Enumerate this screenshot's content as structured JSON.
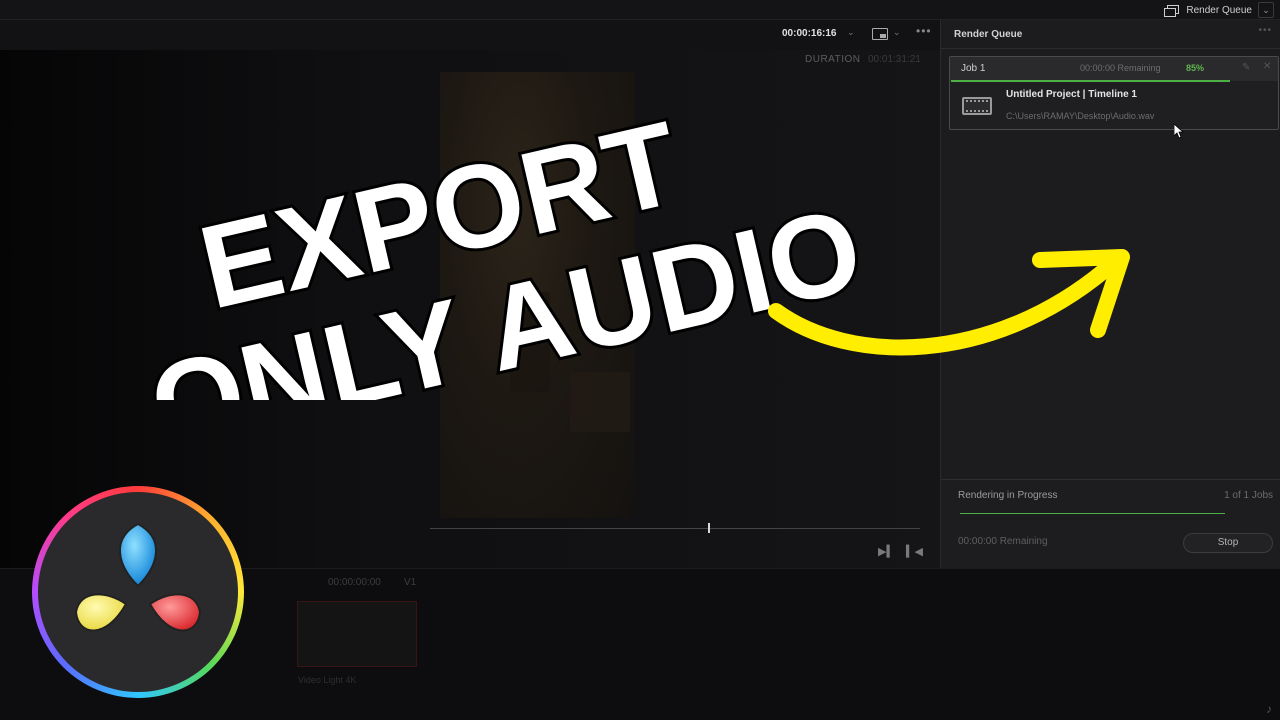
{
  "topbar": {
    "render_queue_label": "Render Queue"
  },
  "viewer": {
    "timecode": "00:00:16:16",
    "duration_label": "DURATION",
    "duration_value": "00:01:31:21"
  },
  "timeline": {
    "timecode": "00:00:00:00",
    "track": "V1",
    "clip_name": "Video Light 4K"
  },
  "render_queue": {
    "title": "Render Queue",
    "job": {
      "name": "Job 1",
      "remaining": "00:00:00 Remaining",
      "percent": "85%",
      "progress": 0.85,
      "project": "Untitled Project | Timeline 1",
      "path": "C:\\Users\\RAMAY\\Desktop\\Audio.wav"
    },
    "footer": {
      "status": "Rendering in Progress",
      "count": "1 of 1 Jobs",
      "remaining": "00:00:00 Remaining",
      "stop_label": "Stop"
    }
  },
  "overlay": {
    "headline_line1": "EXPORT",
    "headline_line2": "ONLY AUDIO",
    "arrow_color": "#ffee00"
  },
  "colors": {
    "accent_green": "#4db045",
    "panel_bg": "#1c1c1f"
  }
}
